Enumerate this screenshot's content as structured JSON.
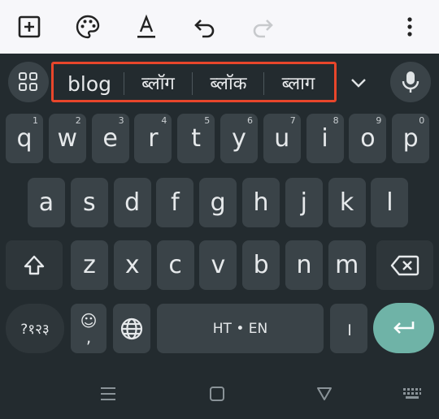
{
  "toolbar": {
    "icons": [
      "add-box-icon",
      "palette-icon",
      "text-format-icon",
      "undo-icon",
      "redo-icon",
      "more-vert-icon"
    ]
  },
  "suggestions": {
    "items": [
      "blog",
      "ब्लॉग",
      "ब्लॉक",
      "ब्लाग"
    ]
  },
  "keyboard": {
    "row1": [
      {
        "label": "q",
        "hint": "1"
      },
      {
        "label": "w",
        "hint": "2"
      },
      {
        "label": "e",
        "hint": "3"
      },
      {
        "label": "r",
        "hint": "4"
      },
      {
        "label": "t",
        "hint": "5"
      },
      {
        "label": "y",
        "hint": "6"
      },
      {
        "label": "u",
        "hint": "7"
      },
      {
        "label": "i",
        "hint": "8"
      },
      {
        "label": "o",
        "hint": "9"
      },
      {
        "label": "p",
        "hint": "0"
      }
    ],
    "row2": [
      "a",
      "s",
      "d",
      "f",
      "g",
      "h",
      "j",
      "k",
      "l"
    ],
    "row3": [
      "z",
      "x",
      "c",
      "v",
      "b",
      "n",
      "m"
    ],
    "symbols_label": "?१२३",
    "emoji_label": "☺",
    "comma_label": ",",
    "space_label": "HT • EN",
    "period_label": "।"
  }
}
